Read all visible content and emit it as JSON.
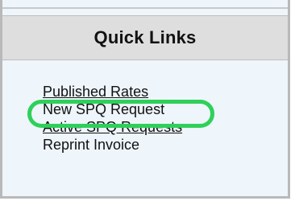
{
  "quick_links": {
    "title": "Quick Links",
    "items": [
      {
        "label": "Published Rates"
      },
      {
        "label": "New SPQ Request"
      },
      {
        "label": "Active SPQ Requests"
      },
      {
        "label": "Reprint Invoice"
      }
    ]
  },
  "colors": {
    "highlight": "#2fd05a",
    "header_bg": "#dedede",
    "panel_bg": "#eef5fb"
  }
}
